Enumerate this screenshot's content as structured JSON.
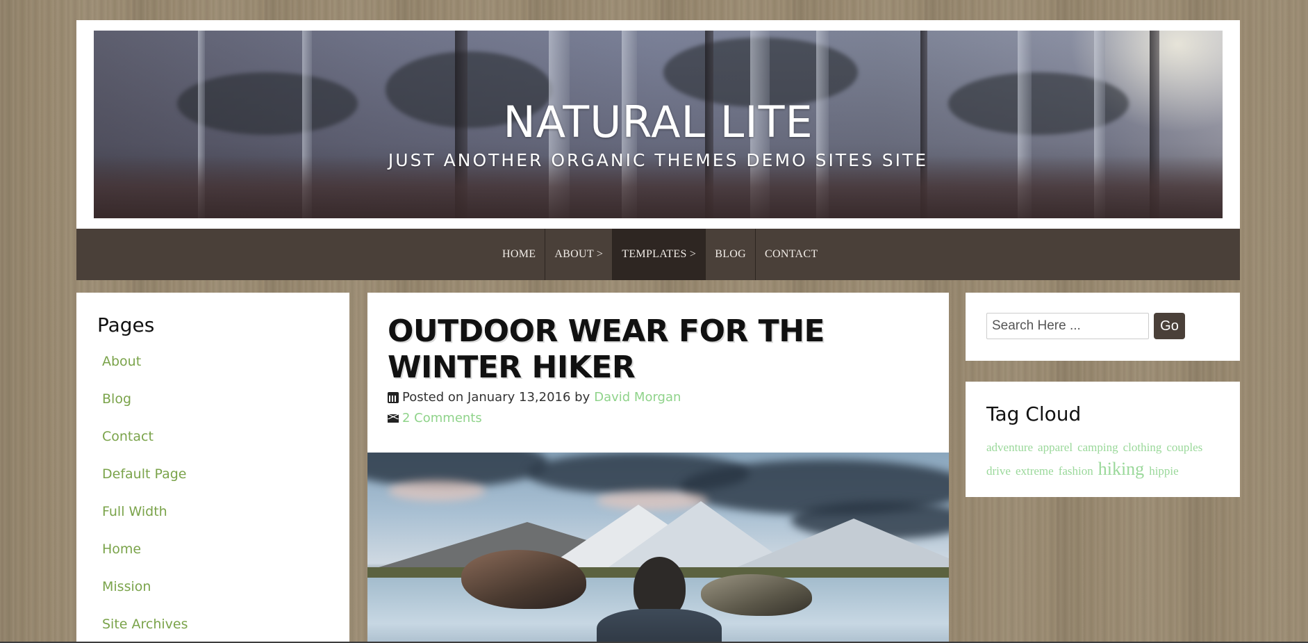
{
  "site": {
    "title": "NATURAL LITE",
    "tagline": "JUST ANOTHER ORGANIC THEMES DEMO SITES SITE"
  },
  "nav": {
    "items": [
      {
        "label": "HOME"
      },
      {
        "label": "ABOUT >"
      },
      {
        "label": "TEMPLATES >"
      },
      {
        "label": "BLOG"
      },
      {
        "label": "CONTACT"
      }
    ],
    "active_index": 2
  },
  "left_sidebar": {
    "heading": "Pages",
    "links": [
      "About",
      "Blog",
      "Contact",
      "Default Page",
      "Full Width",
      "Home",
      "Mission",
      "Site Archives"
    ]
  },
  "post": {
    "title": "OUTDOOR WEAR FOR THE WINTER HIKER",
    "posted_prefix": "Posted on January 13,2016 by",
    "author": "David Morgan",
    "comments": "2 Comments",
    "icons": {
      "date": "calendar-icon",
      "comments": "envelope-icon"
    }
  },
  "search": {
    "placeholder": "Search Here ...",
    "button_label": "Go"
  },
  "tag_cloud": {
    "heading": "Tag Cloud",
    "tags": [
      {
        "label": "adventure",
        "size": 17
      },
      {
        "label": "apparel",
        "size": 17
      },
      {
        "label": "camping",
        "size": 17
      },
      {
        "label": "clothing",
        "size": 17
      },
      {
        "label": "couples",
        "size": 17
      },
      {
        "label": "drive",
        "size": 17
      },
      {
        "label": "extreme",
        "size": 17
      },
      {
        "label": "fashion",
        "size": 17
      },
      {
        "label": "hiking",
        "size": 26
      },
      {
        "label": "hippie",
        "size": 17
      }
    ]
  },
  "colors": {
    "nav_bg": "#4a4039",
    "link_green": "#7aa34a",
    "meta_link_green": "#8fd38a",
    "tag_green": "#9ad89a"
  }
}
